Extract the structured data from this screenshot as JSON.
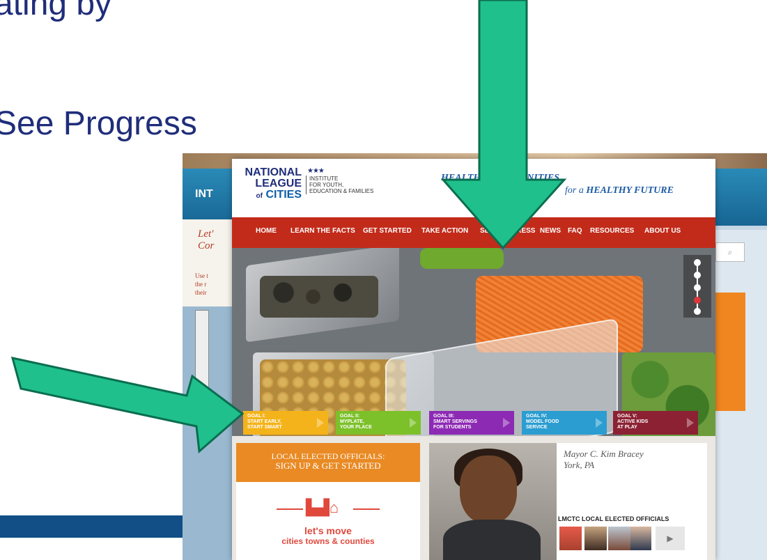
{
  "slide": {
    "text_1": "ating by",
    "text_2": "See Progress"
  },
  "background_site": {
    "header_text": "INT",
    "side_title": "Let'\nCor",
    "side_text": "Use t\nthe r\ntheir",
    "search_icon": "search-icon"
  },
  "site": {
    "logo": {
      "line1": "NATIONAL",
      "line2": "LEAGUE",
      "line3_pre": "of",
      "line3": "CITIES",
      "institute": "INSTITUTE\nFOR YOUTH,\nEDUCATION & FAMILIES"
    },
    "tagline_line1": "HEALTHY COMMUNITIES",
    "tagline_line2_pre": "for a",
    "tagline_line2": "HEALTHY FUTURE",
    "nav": [
      "HOME",
      "LEARN THE FACTS",
      "GET STARTED",
      "TAKE ACTION",
      "SEE PROGRESS",
      "NEWS",
      "FAQ",
      "RESOURCES",
      "ABOUT US"
    ],
    "goals": [
      {
        "label": "GOAL I:\nSTART EARLY,\nSTART SMART",
        "color": "#f4b31a"
      },
      {
        "label": "GOAL II:\nMYPLATE,\nYOUR PLACE",
        "color": "#7cc02a"
      },
      {
        "label": "GOAL III:\nSMART SERVINGS\nFOR STUDENTS",
        "color": "#8d2ab4"
      },
      {
        "label": "GOAL IV:\nMODEL FOOD\nSERVICE",
        "color": "#2b9dd0"
      },
      {
        "label": "GOAL V:\nACTIVE KIDS\nAT PLAY",
        "color": "#8c2133"
      }
    ],
    "signup_line1": "LOCAL ELECTED OFFICIALS:",
    "signup_line2": "SIGN UP & GET STARTED",
    "letsmove_line1": "let's move",
    "letsmove_line2": "cities towns & counties",
    "mayor_name": "Mayor C. Kim Bracey",
    "mayor_city": "York, PA",
    "officials_heading": "LMCTC LOCAL ELECTED OFFICIALS",
    "thumbs_next": "▶"
  },
  "colors": {
    "arrow": "#1fc08c",
    "nav_bg": "#c22b1a",
    "slide_text": "#1f2d7a"
  }
}
